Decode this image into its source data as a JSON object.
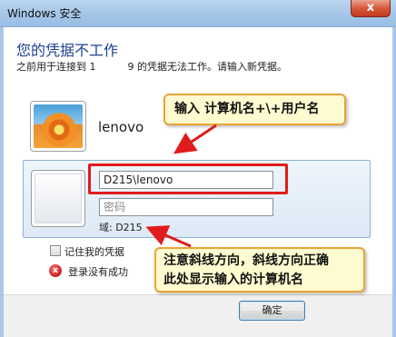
{
  "window": {
    "title": "Windows 安全",
    "close_glyph": "x"
  },
  "dialog": {
    "heading": "您的凭据不工作",
    "subtext": "之前用于连接到 1          9 的凭据无法工作。请输入新凭据。"
  },
  "known_user": {
    "name": "lenovo"
  },
  "credentials": {
    "username_value": "D215\\lenovo",
    "password_placeholder": "密码",
    "domain_label": "域: D215"
  },
  "options": {
    "remember_label": "记住我的凭据",
    "error_label": "登录没有成功",
    "error_glyph": "x"
  },
  "buttons": {
    "ok_label": "确定"
  },
  "annotations": {
    "callout_top": "输入 计算机名+\\+用户名",
    "callout_bottom_line1": "注意斜线方向，斜线方向正确",
    "callout_bottom_line2": "此处显示输入的计算机名"
  },
  "colors": {
    "accent_blue": "#1c3f94",
    "highlight_red": "#e01b1b",
    "callout_fill": "#fffbd0",
    "callout_border": "#e8a436"
  },
  "icons": {
    "error": "error-x-icon",
    "close": "close-icon"
  }
}
